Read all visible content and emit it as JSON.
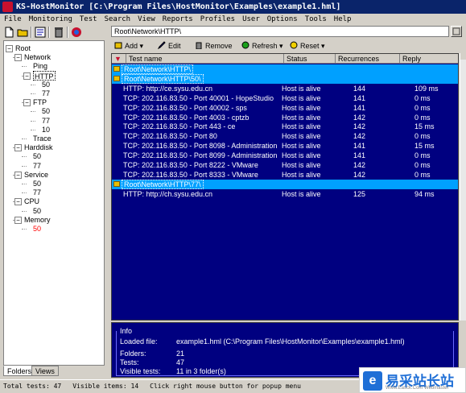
{
  "window": {
    "title": "KS-HostMonitor  [C:\\Program Files\\HostMonitor\\Examples\\example1.hml]"
  },
  "menu": [
    "File",
    "Monitoring",
    "Test",
    "Search",
    "View",
    "Reports",
    "Profiles",
    "User",
    "Options",
    "Tools",
    "Help"
  ],
  "path_bar": {
    "value": "Root\\Network\\HTTP\\"
  },
  "tree": [
    {
      "label": "Root",
      "depth": 0,
      "expander": "minus",
      "selected": false,
      "red": false
    },
    {
      "label": "Network",
      "depth": 1,
      "expander": "minus",
      "selected": false,
      "red": false
    },
    {
      "label": "Ping",
      "depth": 2,
      "expander": "",
      "selected": false,
      "red": false
    },
    {
      "label": "HTTP",
      "depth": 2,
      "expander": "minus",
      "selected": true,
      "red": false
    },
    {
      "label": "50",
      "depth": 3,
      "expander": "",
      "selected": false,
      "red": false
    },
    {
      "label": "77",
      "depth": 3,
      "expander": "",
      "selected": false,
      "red": false
    },
    {
      "label": "FTP",
      "depth": 2,
      "expander": "minus",
      "selected": false,
      "red": false
    },
    {
      "label": "50",
      "depth": 3,
      "expander": "",
      "selected": false,
      "red": false
    },
    {
      "label": "77",
      "depth": 3,
      "expander": "",
      "selected": false,
      "red": false
    },
    {
      "label": "10",
      "depth": 3,
      "expander": "",
      "selected": false,
      "red": false
    },
    {
      "label": "Trace",
      "depth": 2,
      "expander": "",
      "selected": false,
      "red": false
    },
    {
      "label": "Harddisk",
      "depth": 1,
      "expander": "minus",
      "selected": false,
      "red": false
    },
    {
      "label": "50",
      "depth": 2,
      "expander": "",
      "selected": false,
      "red": false
    },
    {
      "label": "77",
      "depth": 2,
      "expander": "",
      "selected": false,
      "red": false
    },
    {
      "label": "Service",
      "depth": 1,
      "expander": "minus",
      "selected": false,
      "red": false
    },
    {
      "label": "50",
      "depth": 2,
      "expander": "",
      "selected": false,
      "red": false
    },
    {
      "label": "77",
      "depth": 2,
      "expander": "",
      "selected": false,
      "red": false
    },
    {
      "label": "CPU",
      "depth": 1,
      "expander": "minus",
      "selected": false,
      "red": false
    },
    {
      "label": "50",
      "depth": 2,
      "expander": "",
      "selected": false,
      "red": false
    },
    {
      "label": "Memory",
      "depth": 1,
      "expander": "minus",
      "selected": false,
      "red": false
    },
    {
      "label": "50",
      "depth": 2,
      "expander": "",
      "selected": false,
      "red": true
    }
  ],
  "tabs": [
    "Folders",
    "Views"
  ],
  "actions": {
    "add": "Add",
    "edit": "Edit",
    "remove": "Remove",
    "refresh": "Refresh",
    "reset": "Reset"
  },
  "columns": {
    "test_name": "Test name",
    "status": "Status",
    "recurrences": "Recurrences",
    "reply": "Reply"
  },
  "rows": [
    {
      "type": "folder",
      "name": "Root\\Network\\HTTP\\"
    },
    {
      "type": "folder",
      "name": "Root\\Network\\HTTP\\50\\"
    },
    {
      "type": "test",
      "name": "HTTP: http://ce.sysu.edu.cn",
      "status": "Host is alive",
      "recurrences": "144",
      "reply": "109 ms"
    },
    {
      "type": "test",
      "name": "TCP: 202.116.83.50 - Port 40001 - HopeStudio",
      "status": "Host is alive",
      "recurrences": "141",
      "reply": "0 ms"
    },
    {
      "type": "test",
      "name": "TCP: 202.116.83.50 - Port 40002 - sps",
      "status": "Host is alive",
      "recurrences": "141",
      "reply": "0 ms"
    },
    {
      "type": "test",
      "name": "TCP: 202.116.83.50 - Port 4003 - cptzb",
      "status": "Host is alive",
      "recurrences": "142",
      "reply": "0 ms"
    },
    {
      "type": "test",
      "name": "TCP: 202.116.83.50 - Port 443 - ce",
      "status": "Host is alive",
      "recurrences": "142",
      "reply": "15 ms"
    },
    {
      "type": "test",
      "name": "TCP: 202.116.83.50 - Port 80",
      "status": "Host is alive",
      "recurrences": "142",
      "reply": "0 ms"
    },
    {
      "type": "test",
      "name": "TCP: 202.116.83.50 - Port 8098 - Administration",
      "status": "Host is alive",
      "recurrences": "141",
      "reply": "15 ms"
    },
    {
      "type": "test",
      "name": "TCP: 202.116.83.50 - Port 8099 - Administration",
      "status": "Host is alive",
      "recurrences": "141",
      "reply": "0 ms"
    },
    {
      "type": "test",
      "name": "TCP: 202.116.83.50 - Port 8222 - VMware",
      "status": "Host is alive",
      "recurrences": "142",
      "reply": "0 ms"
    },
    {
      "type": "test",
      "name": "TCP: 202.116.83.50 - Port 8333 - VMware",
      "status": "Host is alive",
      "recurrences": "142",
      "reply": "0 ms"
    },
    {
      "type": "folder",
      "name": "Root\\Network\\HTTP\\77\\"
    },
    {
      "type": "test",
      "name": "HTTP: http://ch.sysu.edu.cn",
      "status": "Host is alive",
      "recurrences": "125",
      "reply": "94 ms"
    }
  ],
  "info": {
    "legend": "Info",
    "loaded_file_label": "Loaded file:",
    "loaded_file_value": "example1.hml  (C:\\Program Files\\HostMonitor\\Examples\\example1.hml)",
    "folders_label": "Folders:",
    "folders_value": "21",
    "tests_label": "Tests:",
    "tests_value": "47",
    "visible_label": "Visible tests:",
    "visible_value": "11 in 3 folder(s)"
  },
  "status_bar": {
    "total": "Total tests: 47",
    "visible": "Visible items: 14",
    "hint": "Click right mouse button for popup menu"
  },
  "watermark": {
    "text": "易采站长站",
    "sub": "Www.Easck.Com  Webmaster"
  },
  "colors": {
    "grid_bg": "#000080",
    "folder_row": "#00a0ff",
    "title_bar": "#0a246a"
  }
}
